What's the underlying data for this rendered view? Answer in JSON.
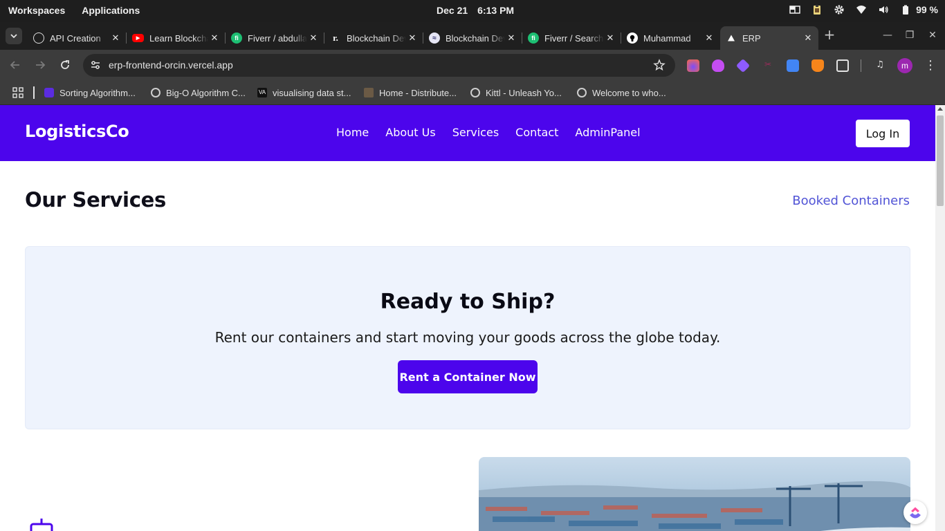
{
  "system_bar": {
    "workspaces": "Workspaces",
    "applications": "Applications",
    "date": "Dec 21",
    "time": "6:13 PM",
    "battery": "99 %"
  },
  "tabs": [
    {
      "title": "API Creation",
      "icon": "chatgpt-icon"
    },
    {
      "title": "Learn Blockchain",
      "icon": "youtube-icon"
    },
    {
      "title": "Fiverr / abdullah",
      "icon": "fiverr-icon"
    },
    {
      "title": "Blockchain Dev",
      "icon": "replit-icon"
    },
    {
      "title": "Blockchain Developer",
      "icon": "ethereum-icon"
    },
    {
      "title": "Fiverr / Search",
      "icon": "fiverr-icon"
    },
    {
      "title": "Muhammad",
      "icon": "github-icon"
    },
    {
      "title": "ERP",
      "icon": "vercel-icon",
      "active": true
    }
  ],
  "address_bar": {
    "url": "erp-frontend-orcin.vercel.app"
  },
  "bookmarks": [
    {
      "label": "Sorting Algorithm..."
    },
    {
      "label": "Big-O Algorithm C..."
    },
    {
      "label": "visualising data st..."
    },
    {
      "label": "Home - Distribute..."
    },
    {
      "label": "Kittl - Unleash Yo..."
    },
    {
      "label": "Welcome to who..."
    }
  ],
  "site": {
    "logo": "LogisticsCo",
    "nav": [
      "Home",
      "About Us",
      "Services",
      "Contact",
      "AdminPanel"
    ],
    "login": "Log In",
    "page_title": "Our Services",
    "booked_link": "Booked Containers",
    "cta": {
      "heading": "Ready to Ship?",
      "text": "Rent our containers and start moving your goods across the globe today.",
      "button": "Rent a Container Now"
    }
  },
  "colors": {
    "brand": "#4c05ec",
    "link": "#5154d6",
    "cta_bg": "#eef3fd"
  }
}
